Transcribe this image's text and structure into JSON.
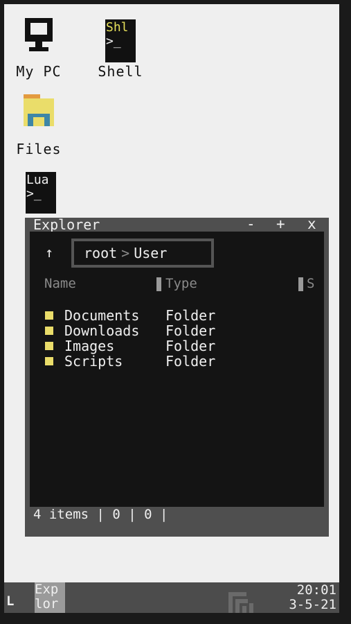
{
  "desktop": {
    "icons": [
      {
        "label": "My PC",
        "glyph": "computer-icon"
      },
      {
        "label": "Shell",
        "glyph": "terminal-icon",
        "glyph_text": "Shl",
        "prompt": ">_"
      },
      {
        "label": "Files",
        "glyph": "folder-icon"
      },
      {
        "label": "",
        "glyph": "terminal-icon",
        "glyph_text": "Lua",
        "prompt": ">_"
      }
    ]
  },
  "explorer": {
    "title": "Explorer",
    "buttons": {
      "minimize": "-",
      "maximize": "+",
      "close": "x"
    },
    "back_arrow": "↑",
    "breadcrumb": {
      "root": "root",
      "separator": ">",
      "current": "User"
    },
    "columns": {
      "name": "Name",
      "type": "Type",
      "size": "S"
    },
    "rows": [
      {
        "name": "Documents",
        "type": "Folder"
      },
      {
        "name": "Downloads",
        "type": "Folder"
      },
      {
        "name": "Images",
        "type": "Folder"
      },
      {
        "name": "Scripts",
        "type": "Folder"
      }
    ],
    "status": "4 items | 0 | 0 |"
  },
  "taskbar": {
    "start": "L",
    "task_label_line1": "Exp",
    "task_label_line2": "lor",
    "time": "20:01",
    "date": "3-5-21"
  },
  "colors": {
    "accent_yellow": "#eadd6a",
    "window_frame": "#4f4f4f",
    "window_content": "#141414",
    "desktop": "#efefef",
    "folder_blue": "#3e86a6"
  }
}
